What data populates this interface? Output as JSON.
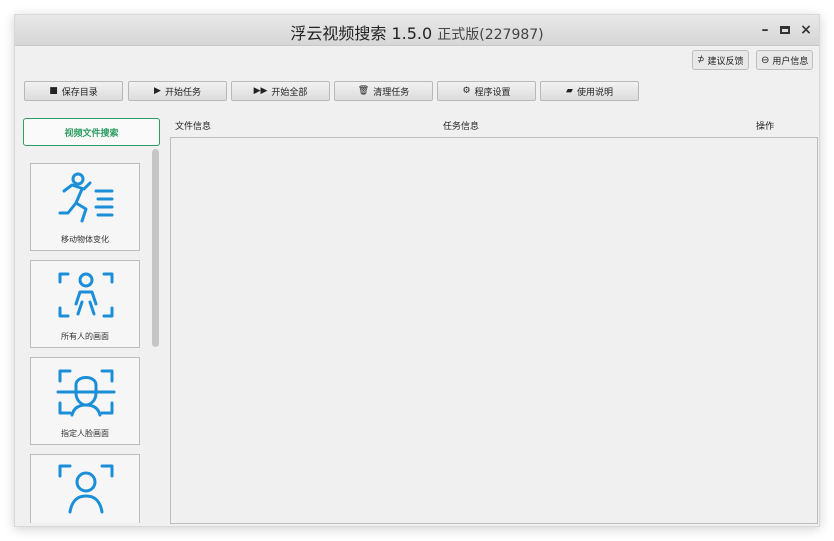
{
  "window": {
    "title": "浮云视频搜索 1.5.0",
    "version": "正式版(227987)",
    "minimize": "–",
    "maximize": "□",
    "close": "×"
  },
  "top_buttons": {
    "feedback": "建议反馈",
    "user_info": "用户信息"
  },
  "toolbar": {
    "save_dir": "保存目录",
    "start_task": "开始任务",
    "start_all": "开始全部",
    "clear_task": "清理任务",
    "settings": "程序设置",
    "manual": "使用说明"
  },
  "sidebar": {
    "active_tab": "视频文件搜索",
    "items": [
      {
        "label": "移动物体变化",
        "icon": "running-person-icon"
      },
      {
        "label": "所有人的画面",
        "icon": "person-scan-icon"
      },
      {
        "label": "指定人脸画面",
        "icon": "face-scan-icon"
      },
      {
        "label": "",
        "icon": "profile-scan-icon"
      }
    ]
  },
  "table": {
    "columns": [
      "文件信息",
      "任务信息",
      "操作"
    ]
  },
  "colors": {
    "accent_green": "#2e9d63",
    "icon_blue": "#1a8fd8"
  }
}
